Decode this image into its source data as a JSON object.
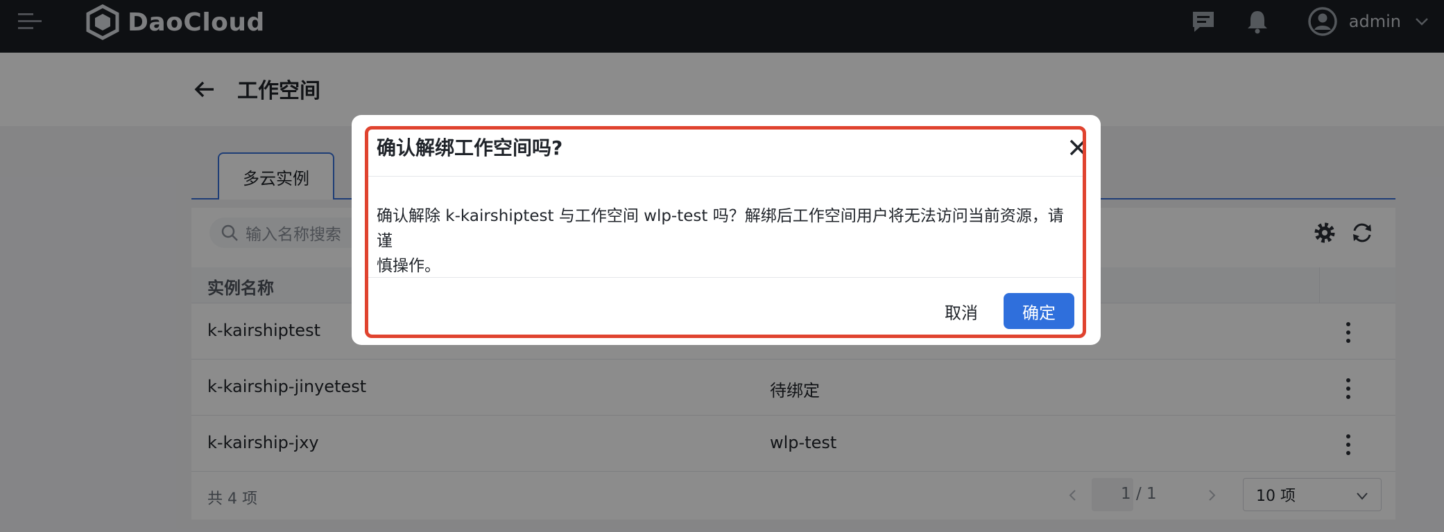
{
  "topbar": {
    "brand": "DaoCloud",
    "user_name": "admin",
    "icons": [
      "menu-icon",
      "message-icon",
      "bell-icon",
      "user-avatar-icon",
      "chevron-down-icon"
    ]
  },
  "page": {
    "title": "工作空间"
  },
  "tabs": [
    {
      "label": "多云实例"
    }
  ],
  "toolbar": {
    "search_placeholder": "输入名称搜索"
  },
  "table": {
    "columns": [
      "实例名称"
    ],
    "rows": [
      {
        "name": "k-kairshiptest",
        "workspace": ""
      },
      {
        "name": "k-kairship-jinyetest",
        "workspace": "待绑定"
      },
      {
        "name": "k-kairship-jxy",
        "workspace": "wlp-test"
      }
    ]
  },
  "pagination": {
    "total": "共 4 项",
    "page": "1 / 1",
    "page_size": "10 项"
  },
  "dialog": {
    "title": "确认解绑工作空间吗?",
    "body_line1": "确认解除 k-kairshiptest 与工作空间 wlp-test 吗？解绑后工作空间用户将无法访问当前资源，请谨",
    "body_line2": "慎操作。",
    "cancel_label": "取消",
    "confirm_label": "确定"
  },
  "colors": {
    "topbar": "#1b1e23",
    "primary": "#2f6fdc",
    "highlight": "#e0432f"
  }
}
